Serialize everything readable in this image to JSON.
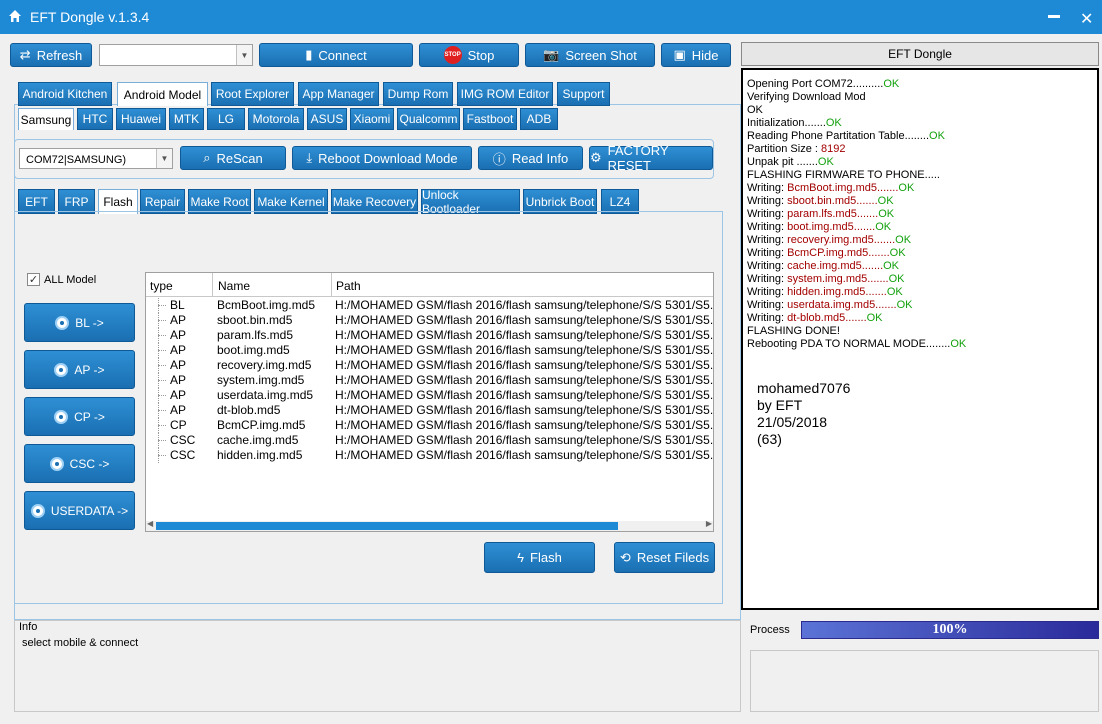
{
  "window": {
    "title": "EFT Dongle  v.1.3.4"
  },
  "toolbar": {
    "refresh": "Refresh",
    "port_combo_value": "",
    "connect": "Connect",
    "stop": "Stop",
    "stop_badge": "STOP",
    "screenshot": "Screen Shot",
    "hide": "Hide",
    "eft_dongle_button": "EFT Dongle"
  },
  "main_tabs": [
    "Android Kitchen",
    "Android Model",
    "Root Explorer",
    "App Manager",
    "Dump Rom",
    "IMG ROM Editor",
    "Support"
  ],
  "main_tab_active": "Android Model",
  "brand_tabs": [
    "Samsung",
    "HTC",
    "Huawei",
    "MTK",
    "LG",
    "Motorola",
    "ASUS",
    "Xiaomi",
    "Qualcomm",
    "Fastboot",
    "ADB"
  ],
  "brand_tab_active": "Samsung",
  "device_bar": {
    "port_value": "COM72|SAMSUNG)",
    "rescan": "ReScan",
    "reboot": "Reboot  Download Mode",
    "read_info": "Read Info",
    "factory_reset": "FACTORY RESET"
  },
  "func_tabs": [
    "EFT",
    "FRP",
    "Flash",
    "Repair",
    "Make Root",
    "Make Kernel",
    "Make Recovery",
    "Unlock Bootloader",
    "Unbrick Boot",
    "LZ4"
  ],
  "func_tab_active": "Flash",
  "flash": {
    "all_model_label": "ALL Model",
    "all_model_checked": true,
    "buttons": [
      "BL ->",
      "AP ->",
      "CP ->",
      "CSC ->",
      "USERDATA ->"
    ],
    "table": {
      "columns": [
        "type",
        "Name",
        "Path"
      ],
      "rows": [
        {
          "type": "BL",
          "name": "BcmBoot.img.md5",
          "path": "H:/MOHAMED GSM/flash 2016/flash samsung/telephone/S/S 5301/S5..."
        },
        {
          "type": "AP",
          "name": "sboot.bin.md5",
          "path": "H:/MOHAMED GSM/flash 2016/flash samsung/telephone/S/S 5301/S5..."
        },
        {
          "type": "AP",
          "name": "param.lfs.md5",
          "path": "H:/MOHAMED GSM/flash 2016/flash samsung/telephone/S/S 5301/S5..."
        },
        {
          "type": "AP",
          "name": "boot.img.md5",
          "path": "H:/MOHAMED GSM/flash 2016/flash samsung/telephone/S/S 5301/S5..."
        },
        {
          "type": "AP",
          "name": "recovery.img.md5",
          "path": "H:/MOHAMED GSM/flash 2016/flash samsung/telephone/S/S 5301/S5..."
        },
        {
          "type": "AP",
          "name": "system.img.md5",
          "path": "H:/MOHAMED GSM/flash 2016/flash samsung/telephone/S/S 5301/S5..."
        },
        {
          "type": "AP",
          "name": "userdata.img.md5",
          "path": "H:/MOHAMED GSM/flash 2016/flash samsung/telephone/S/S 5301/S5..."
        },
        {
          "type": "AP",
          "name": "dt-blob.md5",
          "path": "H:/MOHAMED GSM/flash 2016/flash samsung/telephone/S/S 5301/S5..."
        },
        {
          "type": "CP",
          "name": "BcmCP.img.md5",
          "path": "H:/MOHAMED GSM/flash 2016/flash samsung/telephone/S/S 5301/S5..."
        },
        {
          "type": "CSC",
          "name": "cache.img.md5",
          "path": "H:/MOHAMED GSM/flash 2016/flash samsung/telephone/S/S 5301/S5..."
        },
        {
          "type": "CSC",
          "name": "hidden.img.md5",
          "path": "H:/MOHAMED GSM/flash 2016/flash samsung/telephone/S/S 5301/S5..."
        }
      ]
    },
    "flash_button": "Flash",
    "reset_button": "Reset Fileds"
  },
  "log": {
    "lines": [
      {
        "text": "Opening Port COM72..........",
        "status": "OK",
        "color": "black"
      },
      {
        "text": "Verifying Download Mod",
        "status": "",
        "color": "black"
      },
      {
        "text": "OK",
        "status": "",
        "color": "black"
      },
      {
        "text": "Initialization.......",
        "status": "OK",
        "color": "black"
      },
      {
        "text": "Reading Phone Partitation Table........",
        "status": "OK",
        "color": "black"
      },
      {
        "text": "Partition Size : ",
        "value": "8192",
        "status": "",
        "color": "black"
      },
      {
        "text": "Unpak pit .......",
        "status": "OK",
        "color": "black"
      },
      {
        "text": "FLASHING FIRMWARE TO PHONE.....",
        "status": "",
        "color": "black"
      },
      {
        "text": "Writing: ",
        "file": "BcmBoot.img.md5.......",
        "status": "OK"
      },
      {
        "text": "Writing: ",
        "file": "sboot.bin.md5.......",
        "status": "OK"
      },
      {
        "text": "Writing: ",
        "file": "param.lfs.md5.......",
        "status": "OK"
      },
      {
        "text": "Writing: ",
        "file": "boot.img.md5.......",
        "status": "OK"
      },
      {
        "text": "Writing: ",
        "file": "recovery.img.md5.......",
        "status": "OK"
      },
      {
        "text": "Writing: ",
        "file": "BcmCP.img.md5.......",
        "status": "OK"
      },
      {
        "text": "Writing: ",
        "file": "cache.img.md5.......",
        "status": "OK"
      },
      {
        "text": "Writing: ",
        "file": "system.img.md5.......",
        "status": "OK"
      },
      {
        "text": "Writing: ",
        "file": "hidden.img.md5.......",
        "status": "OK"
      },
      {
        "text": "Writing: ",
        "file": "userdata.img.md5.......",
        "status": "OK"
      },
      {
        "text": "Writing: ",
        "file": "dt-blob.md5.......",
        "status": "OK"
      },
      {
        "text": "FLASHING DONE!",
        "status": "",
        "color": "black"
      },
      {
        "text": "Rebooting PDA TO NORMAL MODE........",
        "status": "OK",
        "color": "black"
      }
    ],
    "signature": [
      "mohamed7076",
      "by EFT",
      "21/05/2018",
      "(63)"
    ],
    "ok_color": "#13a10e",
    "file_color": "#a30000"
  },
  "info": {
    "label": "Info",
    "text": "select mobile & connect"
  },
  "process": {
    "label": "Process",
    "percent_text": "100%",
    "percent": 100
  }
}
